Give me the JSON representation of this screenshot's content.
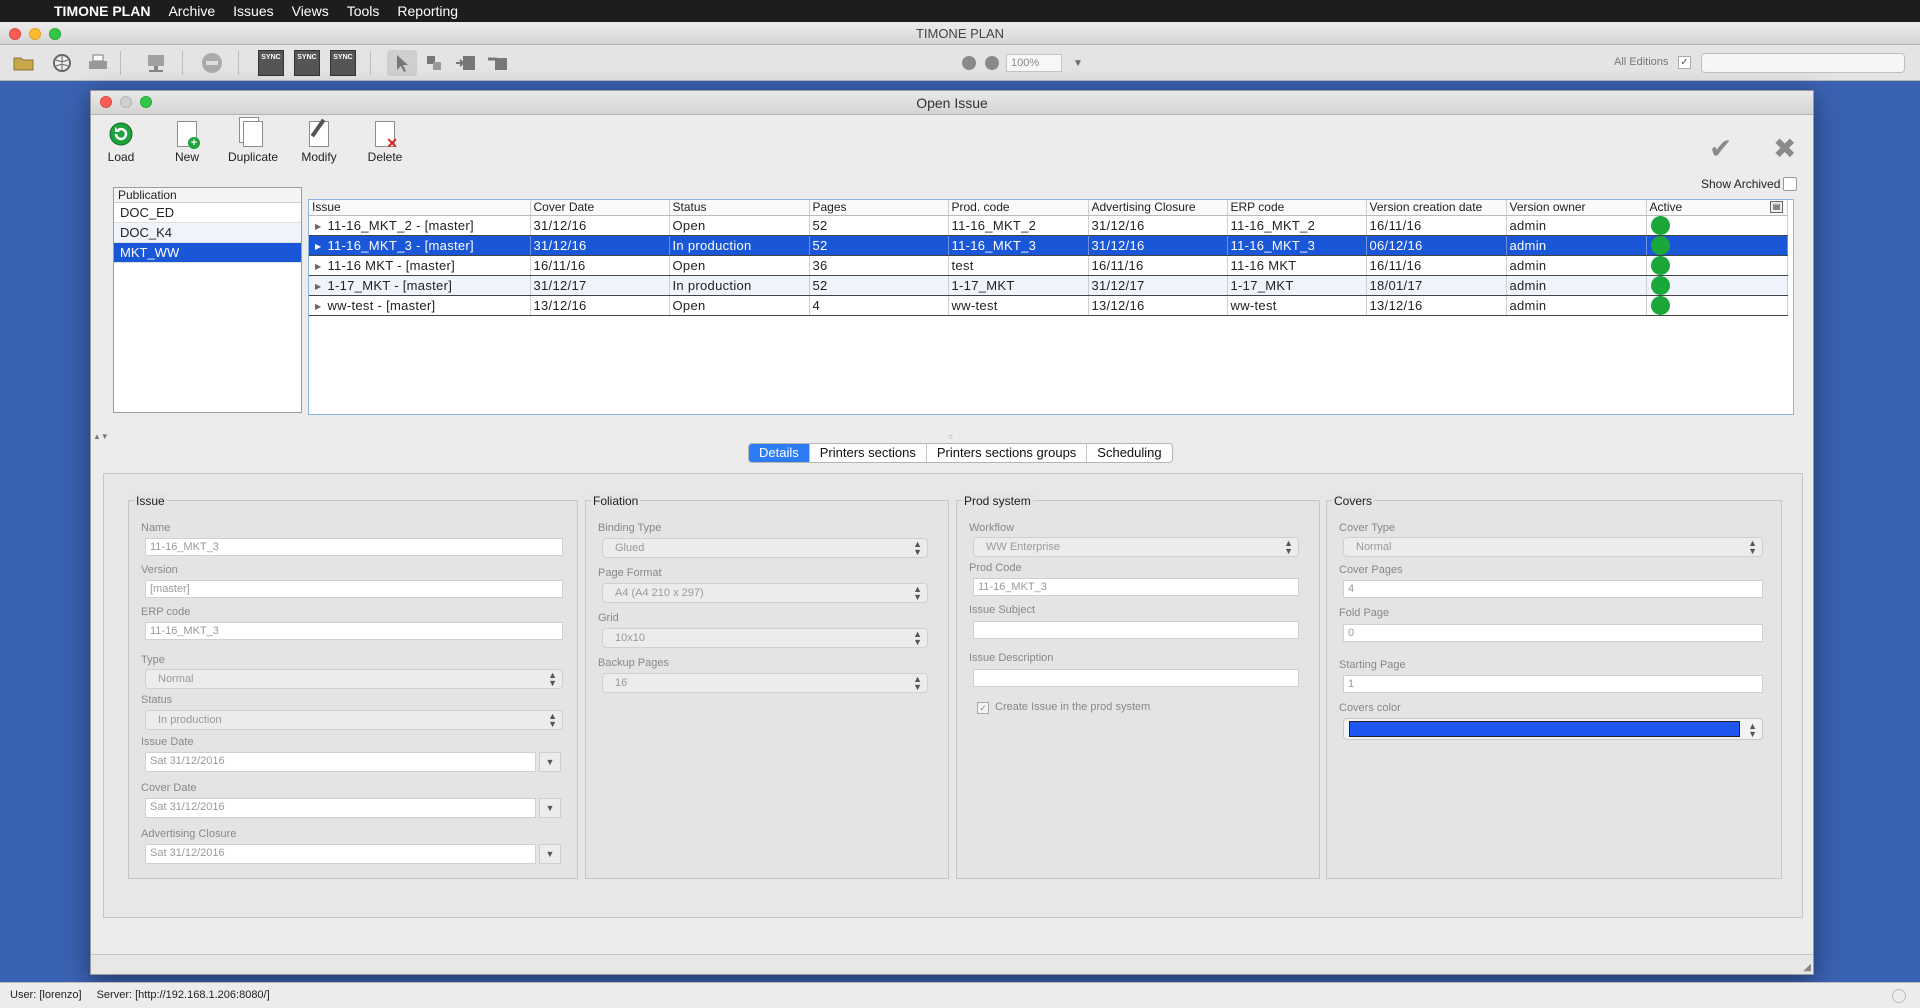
{
  "menubar": {
    "app": "TIMONE PLAN",
    "items": [
      "Archive",
      "Issues",
      "Views",
      "Tools",
      "Reporting"
    ]
  },
  "window": {
    "title": "TIMONE PLAN"
  },
  "toolbar": {
    "zoom": "100%",
    "editions_label": "All Editions",
    "sync_label": "SYNC"
  },
  "dialog": {
    "title": "Open Issue",
    "actions": {
      "load": "Load",
      "new": "New",
      "duplicate": "Duplicate",
      "modify": "Modify",
      "delete": "Delete"
    },
    "show_archived": "Show Archived",
    "publication": {
      "header": "Publication",
      "items": [
        "DOC_ED",
        "DOC_K4",
        "MKT_WW"
      ],
      "selected": "MKT_WW"
    },
    "issues_table": {
      "columns": [
        "Issue",
        "Cover Date",
        "Status",
        "Pages",
        "Prod. code",
        "Advertising Closure",
        "ERP code",
        "Version creation date",
        "Version owner",
        "Active"
      ],
      "rows": [
        [
          "11-16_MKT_2 - [master]",
          "31/12/16",
          "Open",
          "52",
          "11-16_MKT_2",
          "31/12/16",
          "11-16_MKT_2",
          "16/11/16",
          "admin",
          "active"
        ],
        [
          "11-16_MKT_3 - [master]",
          "31/12/16",
          "In production",
          "52",
          "11-16_MKT_3",
          "31/12/16",
          "11-16_MKT_3",
          "06/12/16",
          "admin",
          "active"
        ],
        [
          "11-16 MKT - [master]",
          "16/11/16",
          "Open",
          "36",
          "test",
          "16/11/16",
          "11-16 MKT",
          "16/11/16",
          "admin",
          "active"
        ],
        [
          "1-17_MKT - [master]",
          "31/12/17",
          "In production",
          "52",
          "1-17_MKT",
          "31/12/17",
          "1-17_MKT",
          "18/01/17",
          "admin",
          "active"
        ],
        [
          "ww-test - [master]",
          "13/12/16",
          "Open",
          "4",
          "ww-test",
          "13/12/16",
          "ww-test",
          "13/12/16",
          "admin",
          "active"
        ]
      ],
      "selected_row": 1
    },
    "tabs": [
      "Details",
      "Printers sections",
      "Printers sections groups",
      "Scheduling"
    ],
    "active_tab": "Details",
    "details": {
      "issue": {
        "title": "Issue",
        "name_label": "Name",
        "name": "11-16_MKT_3",
        "version_label": "Version",
        "version": "[master]",
        "erp_label": "ERP code",
        "erp": "11-16_MKT_3",
        "type_label": "Type",
        "type": "Normal",
        "status_label": "Status",
        "status": "In production",
        "issue_date_label": "Issue Date",
        "issue_date": "Sat 31/12/2016",
        "cover_date_label": "Cover Date",
        "cover_date": "Sat 31/12/2016",
        "adv_label": "Advertising Closure",
        "adv": "Sat 31/12/2016"
      },
      "foliation": {
        "title": "Foliation",
        "binding_label": "Binding Type",
        "binding": "Glued",
        "format_label": "Page Format",
        "format": "A4 (A4 210 x 297)",
        "grid_label": "Grid",
        "grid": "10x10",
        "backup_label": "Backup Pages",
        "backup": "16"
      },
      "prod": {
        "title": "Prod system",
        "workflow_label": "Workflow",
        "workflow": "WW Enterprise",
        "code_label": "Prod Code",
        "code": "11-16_MKT_3",
        "subject_label": "Issue Subject",
        "subject": "",
        "desc_label": "Issue Description",
        "desc": "",
        "create_label": "Create Issue in the prod system"
      },
      "covers": {
        "title": "Covers",
        "type_label": "Cover Type",
        "type": "Normal",
        "pages_label": "Cover Pages",
        "pages": "4",
        "fold_label": "Fold Page",
        "fold": "0",
        "start_label": "Starting Page",
        "start": "1",
        "color_label": "Covers color",
        "color": "#1f55f0"
      }
    }
  },
  "statusbar": {
    "user": "User: [lorenzo]",
    "server": "Server: [http://192.168.1.206:8080/]"
  }
}
